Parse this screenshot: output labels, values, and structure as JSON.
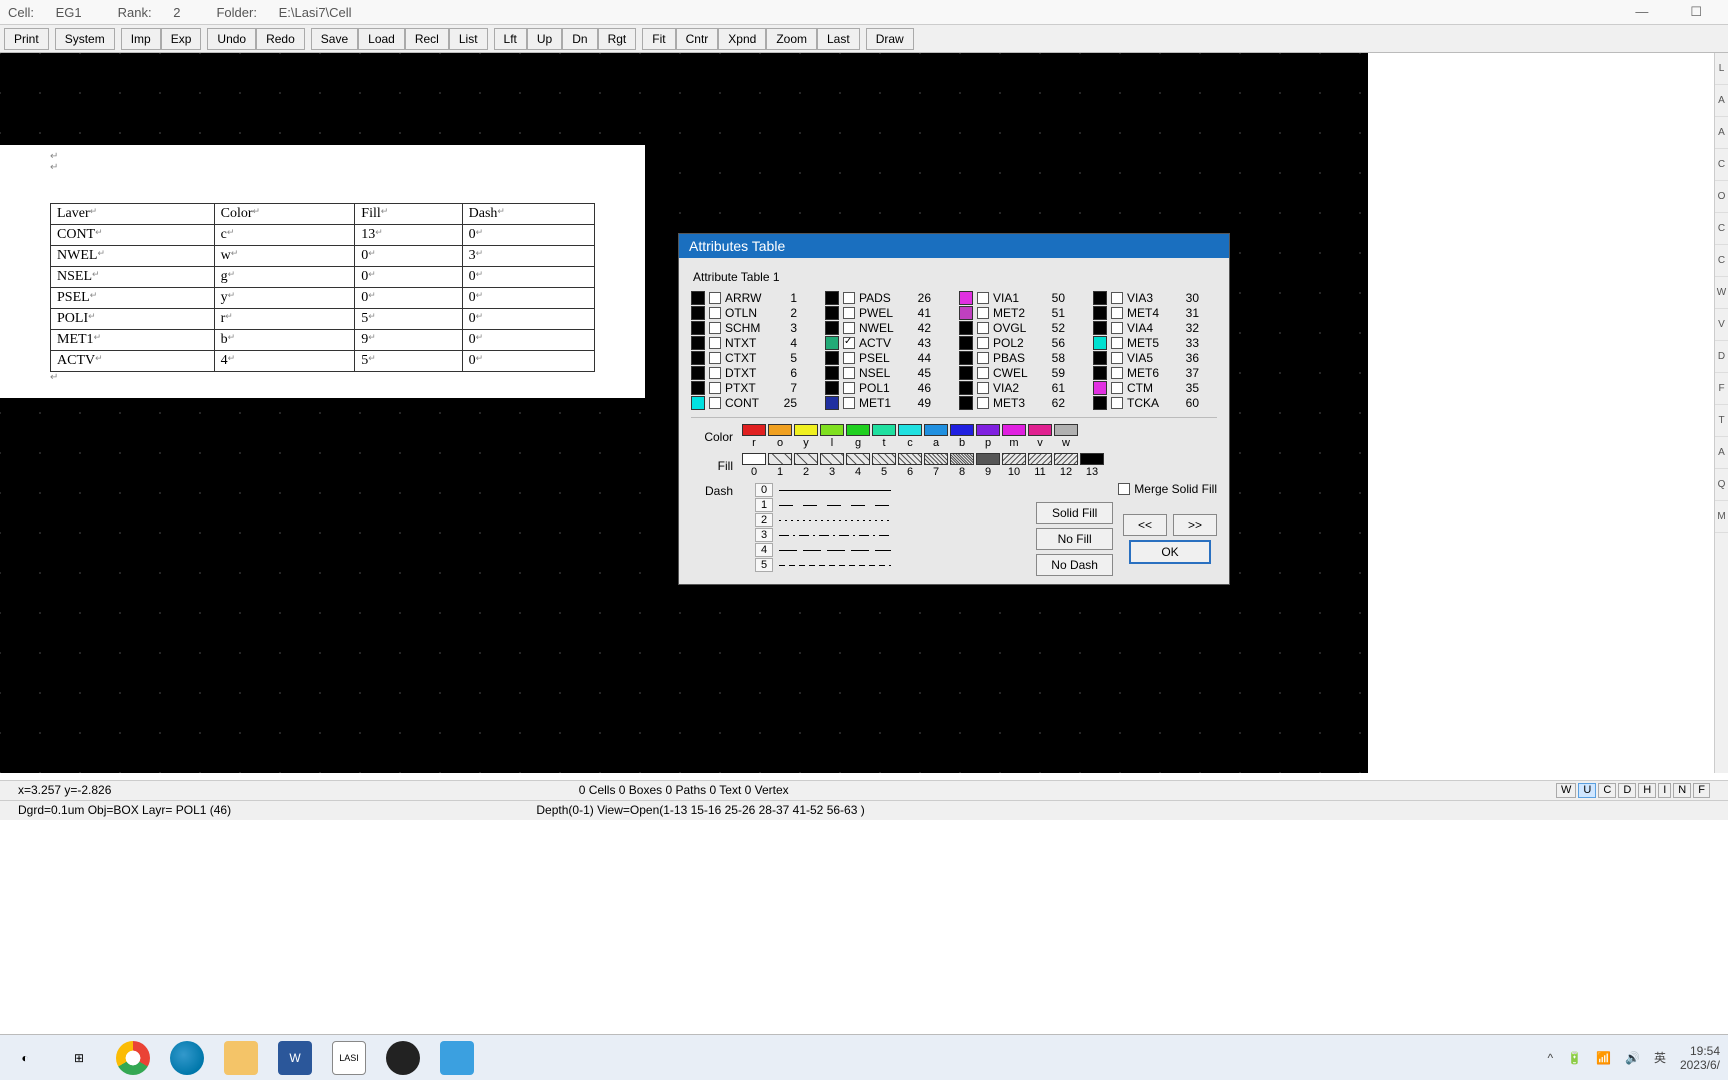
{
  "titlebar": {
    "cell_label": "Cell:",
    "cell_value": "EG1",
    "rank_label": "Rank:",
    "rank_value": "2",
    "folder_label": "Folder:",
    "folder_value": "E:\\Lasi7\\Cell"
  },
  "toolbar": [
    "Print",
    "System",
    "Imp",
    "Exp",
    "Undo",
    "Redo",
    "Save",
    "Load",
    "Recl",
    "List",
    "Lft",
    "Up",
    "Dn",
    "Rgt",
    "Fit",
    "Cntr",
    "Xpnd",
    "Zoom",
    "Last",
    "Draw"
  ],
  "right_letters": [
    "L",
    "A",
    "A",
    "C",
    "O",
    "C",
    "C",
    "W",
    "V",
    "D",
    "F",
    "T",
    "A",
    "Q",
    "M"
  ],
  "doc_table": {
    "headers": [
      "Laver",
      "Color",
      "Fill",
      "Dash"
    ],
    "rows": [
      [
        "CONT",
        "c",
        "13",
        "0"
      ],
      [
        "NWEL",
        "w",
        "0",
        "3"
      ],
      [
        "NSEL",
        "g",
        "0",
        "0"
      ],
      [
        "PSEL",
        "y",
        "0",
        "0"
      ],
      [
        "POLI",
        "r",
        "5",
        "0"
      ],
      [
        "MET1",
        "b",
        "9",
        "0"
      ],
      [
        "ACTV",
        "4",
        "5",
        "0"
      ]
    ]
  },
  "attr": {
    "title": "Attributes Table",
    "subtitle": "Attribute Table 1",
    "cols": [
      [
        {
          "name": "ARRW",
          "num": "1",
          "color": "#000",
          "chk": false
        },
        {
          "name": "OTLN",
          "num": "2",
          "color": "#000",
          "chk": false
        },
        {
          "name": "SCHM",
          "num": "3",
          "color": "#000",
          "chk": false
        },
        {
          "name": "NTXT",
          "num": "4",
          "color": "#000",
          "chk": false
        },
        {
          "name": "CTXT",
          "num": "5",
          "color": "#000",
          "chk": false
        },
        {
          "name": "DTXT",
          "num": "6",
          "color": "#000",
          "chk": false
        },
        {
          "name": "PTXT",
          "num": "7",
          "color": "#000",
          "chk": false
        },
        {
          "name": "CONT",
          "num": "25",
          "color": "#00e0e0",
          "chk": false
        }
      ],
      [
        {
          "name": "PADS",
          "num": "26",
          "color": "#000",
          "chk": false
        },
        {
          "name": "PWEL",
          "num": "41",
          "color": "#000",
          "chk": false
        },
        {
          "name": "NWEL",
          "num": "42",
          "color": "#000",
          "chk": false
        },
        {
          "name": "ACTV",
          "num": "43",
          "color": "#2a7",
          "chk": true
        },
        {
          "name": "PSEL",
          "num": "44",
          "color": "#000",
          "chk": false
        },
        {
          "name": "NSEL",
          "num": "45",
          "color": "#000",
          "chk": false
        },
        {
          "name": "POL1",
          "num": "46",
          "color": "#000",
          "chk": false
        },
        {
          "name": "MET1",
          "num": "49",
          "color": "#2030a0",
          "chk": false
        }
      ],
      [
        {
          "name": "VIA1",
          "num": "50",
          "color": "#e030e0",
          "chk": false
        },
        {
          "name": "MET2",
          "num": "51",
          "color": "#c040c0",
          "chk": false
        },
        {
          "name": "OVGL",
          "num": "52",
          "color": "#000",
          "chk": false
        },
        {
          "name": "POL2",
          "num": "56",
          "color": "#000",
          "chk": false
        },
        {
          "name": "PBAS",
          "num": "58",
          "color": "#000",
          "chk": false
        },
        {
          "name": "CWEL",
          "num": "59",
          "color": "#000",
          "chk": false
        },
        {
          "name": "VIA2",
          "num": "61",
          "color": "#000",
          "chk": false
        },
        {
          "name": "MET3",
          "num": "62",
          "color": "#000",
          "chk": false
        }
      ],
      [
        {
          "name": "VIA3",
          "num": "30",
          "color": "#000",
          "chk": false
        },
        {
          "name": "MET4",
          "num": "31",
          "color": "#000",
          "chk": false
        },
        {
          "name": "VIA4",
          "num": "32",
          "color": "#000",
          "chk": false
        },
        {
          "name": "MET5",
          "num": "33",
          "color": "#00e0d0",
          "chk": false
        },
        {
          "name": "VIA5",
          "num": "36",
          "color": "#000",
          "chk": false
        },
        {
          "name": "MET6",
          "num": "37",
          "color": "#000",
          "chk": false
        },
        {
          "name": "CTM",
          "num": "35",
          "color": "#e030e0",
          "chk": false
        },
        {
          "name": "TCKA",
          "num": "60",
          "color": "#000",
          "chk": false
        }
      ]
    ],
    "color_label": "Color",
    "colors": [
      {
        "c": "#e02020",
        "l": "r"
      },
      {
        "c": "#f0a020",
        "l": "o"
      },
      {
        "c": "#f0f020",
        "l": "y"
      },
      {
        "c": "#80e020",
        "l": "l"
      },
      {
        "c": "#20d020",
        "l": "g"
      },
      {
        "c": "#20e0a0",
        "l": "t"
      },
      {
        "c": "#20e0e0",
        "l": "c"
      },
      {
        "c": "#2090e0",
        "l": "a"
      },
      {
        "c": "#2020e0",
        "l": "b"
      },
      {
        "c": "#8020e0",
        "l": "p"
      },
      {
        "c": "#e020e0",
        "l": "m"
      },
      {
        "c": "#e02090",
        "l": "v"
      },
      {
        "c": "#b0b0b0",
        "l": "w"
      }
    ],
    "fill_label": "Fill",
    "fills": [
      "0",
      "1",
      "2",
      "3",
      "4",
      "5",
      "6",
      "7",
      "8",
      "9",
      "10",
      "11",
      "12",
      "13"
    ],
    "dash_label": "Dash",
    "dashes": [
      "0",
      "1",
      "2",
      "3",
      "4",
      "5"
    ],
    "merge_label": "Merge Solid Fill",
    "btn_solidfill": "Solid Fill",
    "btn_nofill": "No Fill",
    "btn_nodash": "No Dash",
    "btn_prev": "<<",
    "btn_next": ">>",
    "btn_ok": "OK"
  },
  "status": {
    "coords": "x=3.257  y=-2.826",
    "objects": "0 Cells  0 Boxes  0 Paths  0 Text  0 Vertex",
    "grid": "Dgrd=0.1um  Obj=BOX  Layr= POL1 (46)",
    "depth": "Depth(0-1)  View=Open(1-13 15-16 25-26 28-37 41-52 56-63 )",
    "keys": [
      "W",
      "U",
      "C",
      "D",
      "H",
      "I",
      "N",
      "F"
    ],
    "key_on_index": 1
  },
  "taskbar": {
    "time": "19:54",
    "date": "2023/6/",
    "lang": "英",
    "icons": [
      "◯",
      "⊞",
      "◐",
      "◑",
      "▭",
      "W",
      "▦",
      "●",
      "▭"
    ]
  }
}
